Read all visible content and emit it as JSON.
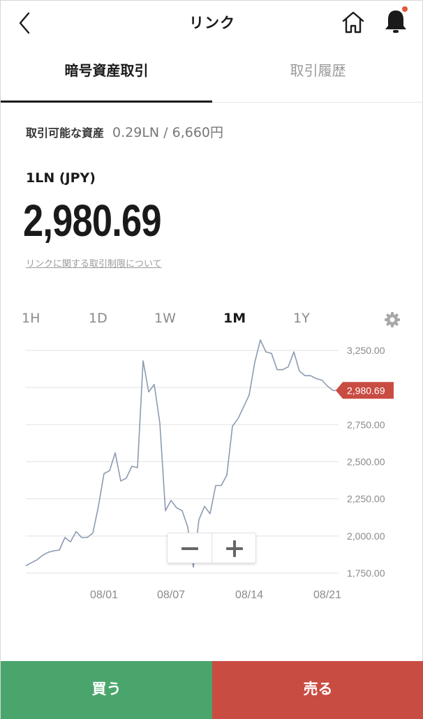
{
  "header": {
    "title": "リンク",
    "icons": [
      "chevron-left-icon",
      "home-icon",
      "bell-icon"
    ]
  },
  "tabs": [
    {
      "label": "暗号資産取引",
      "active": true
    },
    {
      "label": "取引履歴",
      "active": false
    }
  ],
  "asset": {
    "tradable_label": "取引可能な資産",
    "tradable_value": "0.29LN / 6,660円",
    "pair": "1LN (JPY)",
    "price": "2,980.69",
    "limit_link": "リンクに関する取引制限について"
  },
  "ranges": [
    {
      "label": "1H",
      "active": false
    },
    {
      "label": "1D",
      "active": false
    },
    {
      "label": "1W",
      "active": false
    },
    {
      "label": "1M",
      "active": true
    },
    {
      "label": "1Y",
      "active": false
    }
  ],
  "chart_data": {
    "type": "line",
    "x_ticks": [
      "08/01",
      "08/07",
      "08/14",
      "08/21"
    ],
    "y_ticks": [
      "3,250.00",
      "3,000.00",
      "2,750.00",
      "2,500.00",
      "2,250.00",
      "2,000.00",
      "1,750.00"
    ],
    "ylim": [
      1750,
      3250
    ],
    "grid": true,
    "current_value_label": "2,980.69",
    "current_value": 2980.69,
    "series": [
      {
        "x": [
          "07/25",
          "07/26",
          "07/26",
          "07/27",
          "07/27",
          "07/28",
          "07/28",
          "07/29",
          "07/29",
          "07/30",
          "07/30",
          "07/31",
          "07/31",
          "08/01",
          "08/01",
          "08/02",
          "08/02",
          "08/03",
          "08/03",
          "08/04",
          "08/04",
          "08/05",
          "08/05",
          "08/06",
          "08/06",
          "08/07",
          "08/07",
          "08/08",
          "08/08",
          "08/09",
          "08/09",
          "08/10",
          "08/10",
          "08/11",
          "08/11",
          "08/12",
          "08/12",
          "08/13",
          "08/13",
          "08/14",
          "08/14",
          "08/15",
          "08/15",
          "08/16",
          "08/16",
          "08/17",
          "08/17",
          "08/18",
          "08/18",
          "08/19",
          "08/19",
          "08/20",
          "08/20",
          "08/21",
          "08/21",
          "08/22"
        ],
        "values": [
          1800,
          1840,
          1870,
          1890,
          1900,
          1905,
          1990,
          1960,
          2030,
          1990,
          1990,
          2020,
          2200,
          2420,
          2440,
          2560,
          2370,
          2390,
          2470,
          2460,
          3180,
          2970,
          3020,
          2760,
          2170,
          2240,
          2190,
          2170,
          2060,
          1790,
          2110,
          2200,
          2150,
          2340,
          2340,
          2410,
          2740,
          2790,
          2870,
          2950,
          3170,
          3320,
          3240,
          3230,
          3120,
          3120,
          3140,
          3240,
          3110,
          3080,
          3080,
          3060,
          3050,
          3010,
          2980.69,
          2980.69
        ]
      }
    ]
  },
  "zoom": {
    "minus": "−",
    "plus": "+"
  },
  "actions": {
    "buy": "買う",
    "sell": "売る"
  },
  "colors": {
    "buy": "#4aa56c",
    "sell": "#c94c42",
    "line": "#8c9bb0",
    "notification": "#e05a3c"
  }
}
